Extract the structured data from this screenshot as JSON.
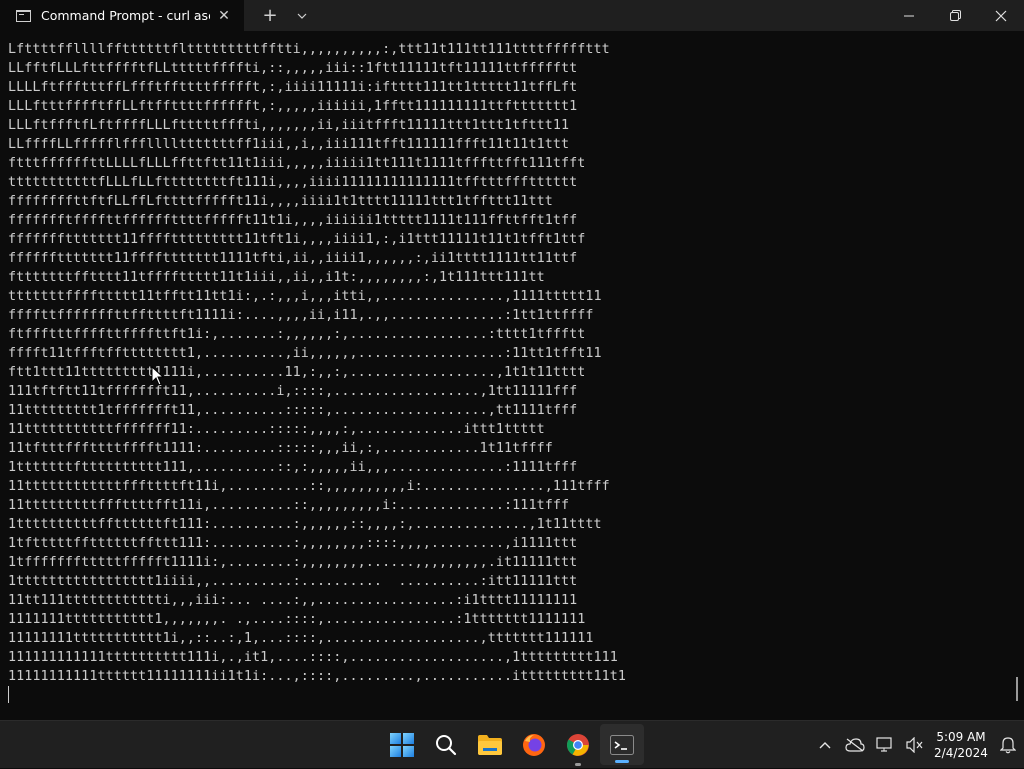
{
  "window": {
    "tab_title": "Command Prompt - curl  ascii",
    "tab_icon": "cmd-icon",
    "close_tab": "✕",
    "new_tab": "+",
    "dropdown": "⌄"
  },
  "terminal": {
    "lines": [
      "Lfttttffllllffttttttfltttttttttfftti,,,,,,,,,,:,ttt11t111tt111ttttfffffttt",
      "LLfftfLLLfttfffftfLLtttttffffti,::,,,,,iii::1ftt11111tft11111ttffffftt",
      "LLLLftffftttffLffftffttttffffft,:,iiii11111i:iftttt111tt1ttttt11tffLft",
      "LLLftttfffftffLLftffttttfffffft,:,,,,,iiiiii,1fftt111111111ttfttttttt1",
      "LLLftffftfLftffffLLLftttttfffti,,,,,,,ii,iiitffft11111ttt1ttt1tfttt11",
      "LLffffLLffffflffflllltttttttff1iii,,i,,iii111tfft111111ffft11t11t1ttt",
      "ftttffffffttLLLLfLLLffttftt11t1iii,,,,,iiiii1tt111t1111tfffttfft111tfft",
      "tttttttttttfLLLfLLfttttttttft111i,,,,iiii11111111111111tfftttffftttttt",
      "ffffffffttftfLLffLfttttffffft11i,,,,iiii1t1tttt11111ttt1tffttt11ttt",
      "ffffffftffffttffffffttttffffft11t1i,,,,iiiiii1ttttt1111t111ffttfft1tff",
      "fffffffttttttt11ffffttttttttt11tft1i,,,,iiii1,:,i1ttt11111t11t1tfft1ttf",
      "ffffffttttttt11ffffttttttt1111tfti,ii,,iiii1,,,,,,:,ii1tttt1111tt11ttf",
      "ftttttttfftttt11tffffttttt11t1iii,,ii,,i1t:,,,,,,,,:,1t111ttt111tt",
      "tttttttffffttttt11tfftt11tt1i:,.:,,,i,,,itti,,...............,1111ttttt11",
      "ffffttfffffffttffttttft1111i:....,,,,ii,i11,.,,..............:1tt1ttffff",
      "ftffftttffffttffffttft1i:,.......:,,,,,,:,.................:tttt1tffftt",
      "fffft11tffftfftttttttt1,..........,ii,,,,,,..................:11tt1tfft11",
      "ftt1ttt11ttttttttt1111i,..........11,:,,:,..................,1t1t11tttt",
      "111tftftt11tffffffft11,..........i,::::,..................,1tt11111fff",
      "11ttttttttt1tffffffft11,..........:::::,...................,tt1111tfff",
      "11tttttttttttfffffff11:.........:::::,,,,:,.............ittt1ttttt",
      "11tftttfffttttfffft1111:.........:::::,,,ii,:,............1t11tffff",
      "1tttttttftttttttttt111,..........::,:,,,,,ii,,,..............:1111tfff",
      "11ttttttttttttfffttttft11i,..........::,,,,,,,,,,i:...............,111tfff",
      "11tttttttttfffttttfft11i,..........::,,,,,,,,,i:.............:111tfff",
      "1ttttttttttffttttttft111:..........:,,,,,,::,,,,:,..............,1t11tttt",
      "1tftttttffttttttffttt111:..........:,,,,,,,,::::,,,,.........,i1111ttt",
      "1tffffffftttttffffft1111i:,........:,,,,,,,,......,,,,,,,,,.it11111ttt",
      "1ttttttttttttttttt1iiii,,..........:..........  ..........:itt11111ttt",
      "11tt111tttttttttttti,,,iii:... ....:,,.................:i1tttt11111111",
      "1111111ttttttttttt1,,,,,,,. .,....::::,................:1ttttttt1111111",
      "11111111ttttttttttt1i,,::..:,1,...::::,...................,ttttttt111111",
      "111111111111tttttttttt111i,.,it1,....::::,...................,1ttttttttt111",
      "11111111111tttttt11111111ii1t1i:...,::::,.........,...........ittttttttt11t1"
    ]
  },
  "taskbar": {
    "apps": [
      {
        "name": "start-button",
        "icon": "windows-logo-icon"
      },
      {
        "name": "search-button",
        "icon": "search-icon"
      },
      {
        "name": "file-explorer-button",
        "icon": "folder-icon"
      },
      {
        "name": "firefox-button",
        "icon": "firefox-icon"
      },
      {
        "name": "chrome-button",
        "icon": "chrome-icon"
      },
      {
        "name": "terminal-button",
        "icon": "terminal-icon"
      }
    ],
    "clock": {
      "time": "5:09 AM",
      "date": "2/4/2024"
    }
  },
  "colors": {
    "terminal_bg": "#0c0c0c",
    "text": "#cccccc",
    "accent": "#5ab0ff"
  }
}
